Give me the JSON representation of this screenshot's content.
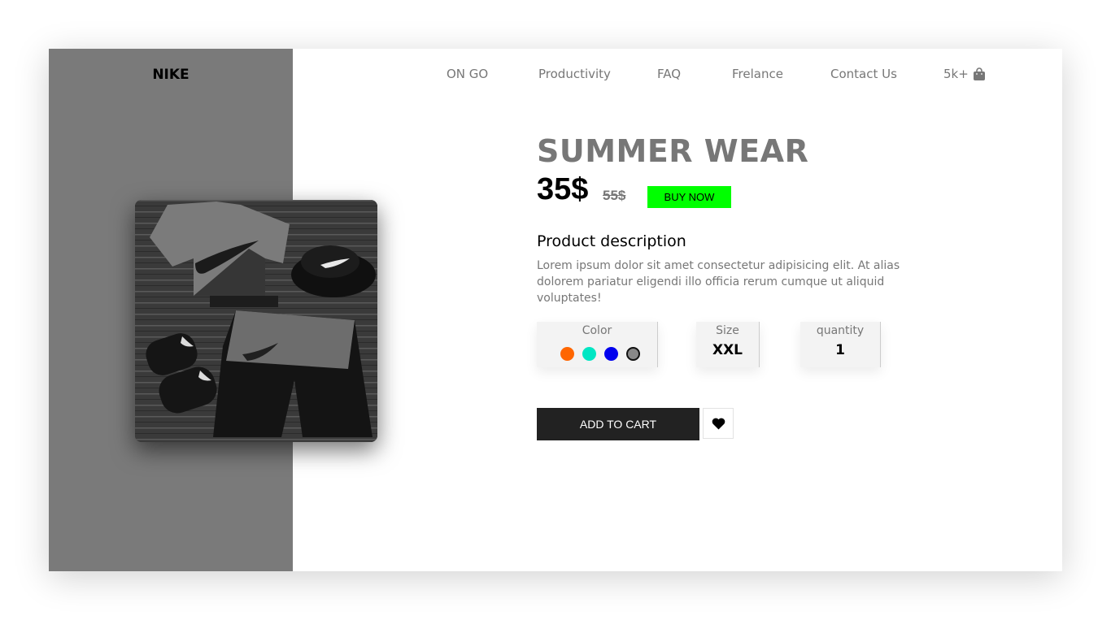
{
  "brand": "NIKE",
  "nav": {
    "items": [
      "ON GO",
      "Productivity",
      "FAQ",
      "Frelance",
      "Contact Us"
    ],
    "cart_count": "5k+",
    "cart_icon": "shopping-bag-icon"
  },
  "product": {
    "title": "SUMMER WEAR",
    "price": "35$",
    "old_price": "55$",
    "buy_now_label": "BUY NOW",
    "description_heading": "Product description",
    "description": "Lorem ipsum dolor sit amet consectetur adipisicing elit. At alias dolorem pariatur eligendi illo officia rerum cumque ut aliquid voluptates!"
  },
  "options": {
    "color_label": "Color",
    "colors": [
      "#ff6600",
      "#00e6c3",
      "#0000ee",
      "#888888"
    ],
    "selected_color": "#888888",
    "size_label": "Size",
    "size_value": "XXL",
    "quantity_label": "quantity",
    "quantity_value": "1"
  },
  "actions": {
    "add_to_cart_label": "ADD TO CART",
    "wishlist_icon": "heart-icon"
  },
  "colors": {
    "left_panel": "#7a7a7a",
    "buy_now_bg": "#00ff00",
    "cart_button_bg": "#222222",
    "muted_text": "#777777"
  }
}
